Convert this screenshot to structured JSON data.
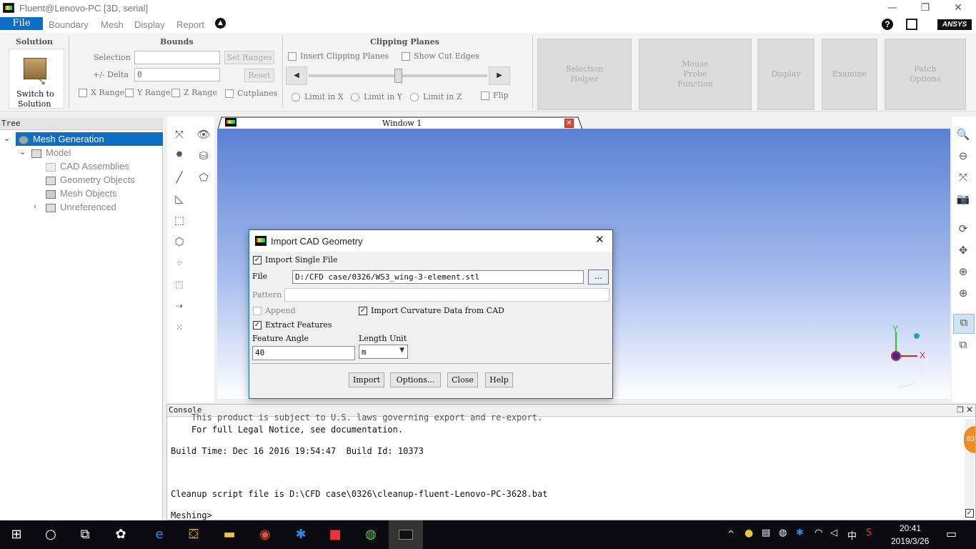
{
  "window": {
    "title": "Fluent@Lenovo-PC  [3D, serial]",
    "min": "—",
    "max": "❐",
    "close": "✕"
  },
  "menu": {
    "file": "File",
    "items": [
      "Boundary",
      "Mesh",
      "Display",
      "Report"
    ],
    "help": "?",
    "brand": "ANSYS"
  },
  "ribbon": {
    "solution": {
      "title": "Solution",
      "switch_label_1": "Switch to",
      "switch_label_2": "Solution"
    },
    "bounds": {
      "title": "Bounds",
      "selection_label": "Selection",
      "selection_value": "",
      "delta_label": "+/- Delta",
      "delta_value": "0",
      "set_ranges": "Set Ranges",
      "reset": "Reset",
      "x_range": "X Range",
      "y_range": "Y Range",
      "z_range": "Z Range",
      "cutplanes": "Cutplanes"
    },
    "clipping": {
      "title": "Clipping Planes",
      "insert": "Insert Clipping Planes",
      "show_cut": "Show Cut Edges",
      "limit_x": "Limit in X",
      "limit_y": "Limit in Y",
      "limit_z": "Limit in Z",
      "flip": "Flip"
    },
    "tools": {
      "selection_helper_1": "Selection",
      "selection_helper_2": "Helper",
      "mouse_probe_1": "Mouse",
      "mouse_probe_2": "Probe",
      "mouse_probe_3": "Function",
      "display": "Display",
      "examine": "Examine",
      "patch_1": "Patch",
      "patch_2": "Options"
    }
  },
  "tree": {
    "header": "Tree",
    "root": "Mesh Generation",
    "model": "Model",
    "items": [
      "CAD Assemblies",
      "Geometry Objects",
      "Mesh Objects",
      "Unreferenced"
    ]
  },
  "graphics": {
    "tab_title": "Window 1",
    "axis_x": "X",
    "axis_y": "Y"
  },
  "console": {
    "header": "Console",
    "lines": [
      "    This product is subject to U.S. laws governing export and re-export.",
      "    For full Legal Notice, see documentation.",
      "",
      "Build Time: Dec 16 2016 19:54:47  Build Id: 10373",
      "",
      "",
      "",
      "Cleanup script file is D:\\CFD case\\0326\\cleanup-fluent-Lenovo-PC-3628.bat",
      "",
      "Meshing>"
    ],
    "badge": "83"
  },
  "dialog": {
    "title": "Import CAD Geometry",
    "import_single": "Import Single File",
    "file_label": "File",
    "file_value": "D:/CFD case/0326/WS3_wing-3-element.stl",
    "browse": "...",
    "pattern_label": "Pattern",
    "append": "Append",
    "curvature": "Import Curvature Data from CAD",
    "extract": "Extract Features",
    "feature_angle_label": "Feature Angle",
    "feature_angle_value": "40",
    "length_unit_label": "Length Unit",
    "length_unit_value": "m",
    "buttons": {
      "import": "Import",
      "options": "Options...",
      "close": "Close",
      "help": "Help"
    }
  },
  "taskbar": {
    "time": "20:41",
    "date": "2019/3/26",
    "ime": "中"
  }
}
